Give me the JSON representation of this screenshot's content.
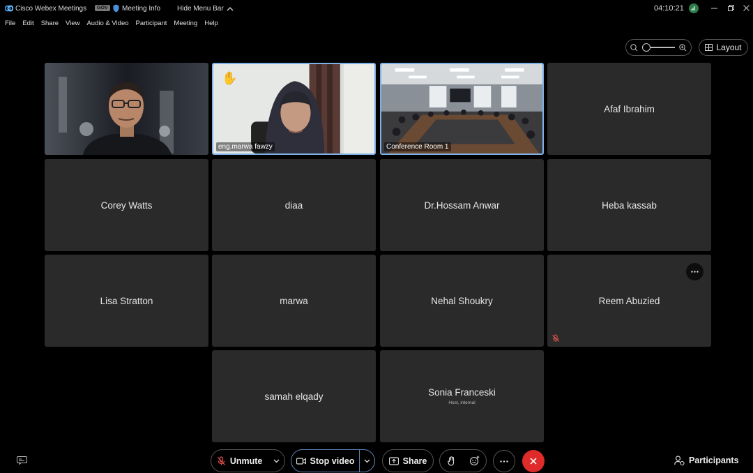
{
  "titlebar": {
    "app_title": "Cisco Webex Meetings",
    "gov_badge": "GOV",
    "meeting_info": "Meeting Info",
    "hide_menu": "Hide Menu Bar",
    "clock": "04:10:21"
  },
  "menubar": {
    "items": [
      "File",
      "Edit",
      "Share",
      "View",
      "Audio & Video",
      "Participant",
      "Meeting",
      "Help"
    ]
  },
  "layout_button": "Layout",
  "tiles": [
    {
      "name": "",
      "type": "video"
    },
    {
      "name": "eng.marwa fawzy",
      "type": "video",
      "hand_raised": true
    },
    {
      "name": "Conference Room 1",
      "type": "video"
    },
    {
      "name": "Afaf Ibrahim",
      "type": "name"
    },
    {
      "name": "Corey Watts",
      "type": "name"
    },
    {
      "name": "diaa",
      "type": "name"
    },
    {
      "name": "Dr.Hossam Anwar",
      "type": "name"
    },
    {
      "name": "Heba kassab",
      "type": "name"
    },
    {
      "name": "Lisa Stratton",
      "type": "name"
    },
    {
      "name": "marwa",
      "type": "name"
    },
    {
      "name": "Nehal Shoukry",
      "type": "name"
    },
    {
      "name": "Reem Abuzied",
      "type": "name",
      "muted": true
    },
    {
      "name": "samah elqady",
      "type": "name"
    },
    {
      "name": "Sonia Franceski",
      "type": "name",
      "subtitle": "Host, internal"
    }
  ],
  "controls": {
    "unmute": "Unmute",
    "stop_video": "Stop video",
    "share": "Share",
    "participants": "Participants"
  },
  "colors": {
    "tile_bg": "#2a2a2a",
    "active_border": "#7fb2e6",
    "end_call": "#e02b2b"
  }
}
